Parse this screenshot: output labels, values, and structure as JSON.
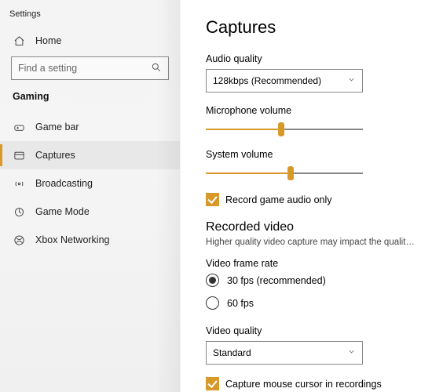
{
  "colors": {
    "accent": "#d8992b"
  },
  "sidebar": {
    "title": "Settings",
    "home": "Home",
    "search_placeholder": "Find a setting",
    "section": "Gaming",
    "items": [
      {
        "label": "Game bar"
      },
      {
        "label": "Captures"
      },
      {
        "label": "Broadcasting"
      },
      {
        "label": "Game Mode"
      },
      {
        "label": "Xbox Networking"
      }
    ]
  },
  "main": {
    "title": "Captures",
    "audio_quality": {
      "label": "Audio quality",
      "value": "128kbps (Recommended)"
    },
    "mic": {
      "label": "Microphone volume",
      "value_pct": 48
    },
    "sys": {
      "label": "System volume",
      "value_pct": 54
    },
    "record_audio_only": {
      "label": "Record game audio only",
      "checked": true
    },
    "recorded_video": {
      "heading": "Recorded video",
      "description": "Higher quality video capture may impact the quality of your game.",
      "frame_rate_label": "Video frame rate",
      "fps30": "30 fps (recommended)",
      "fps60": "60 fps",
      "selected_fps": "30",
      "video_quality_label": "Video quality",
      "video_quality_value": "Standard",
      "capture_cursor": {
        "label": "Capture mouse cursor in recordings",
        "checked": true
      }
    }
  }
}
